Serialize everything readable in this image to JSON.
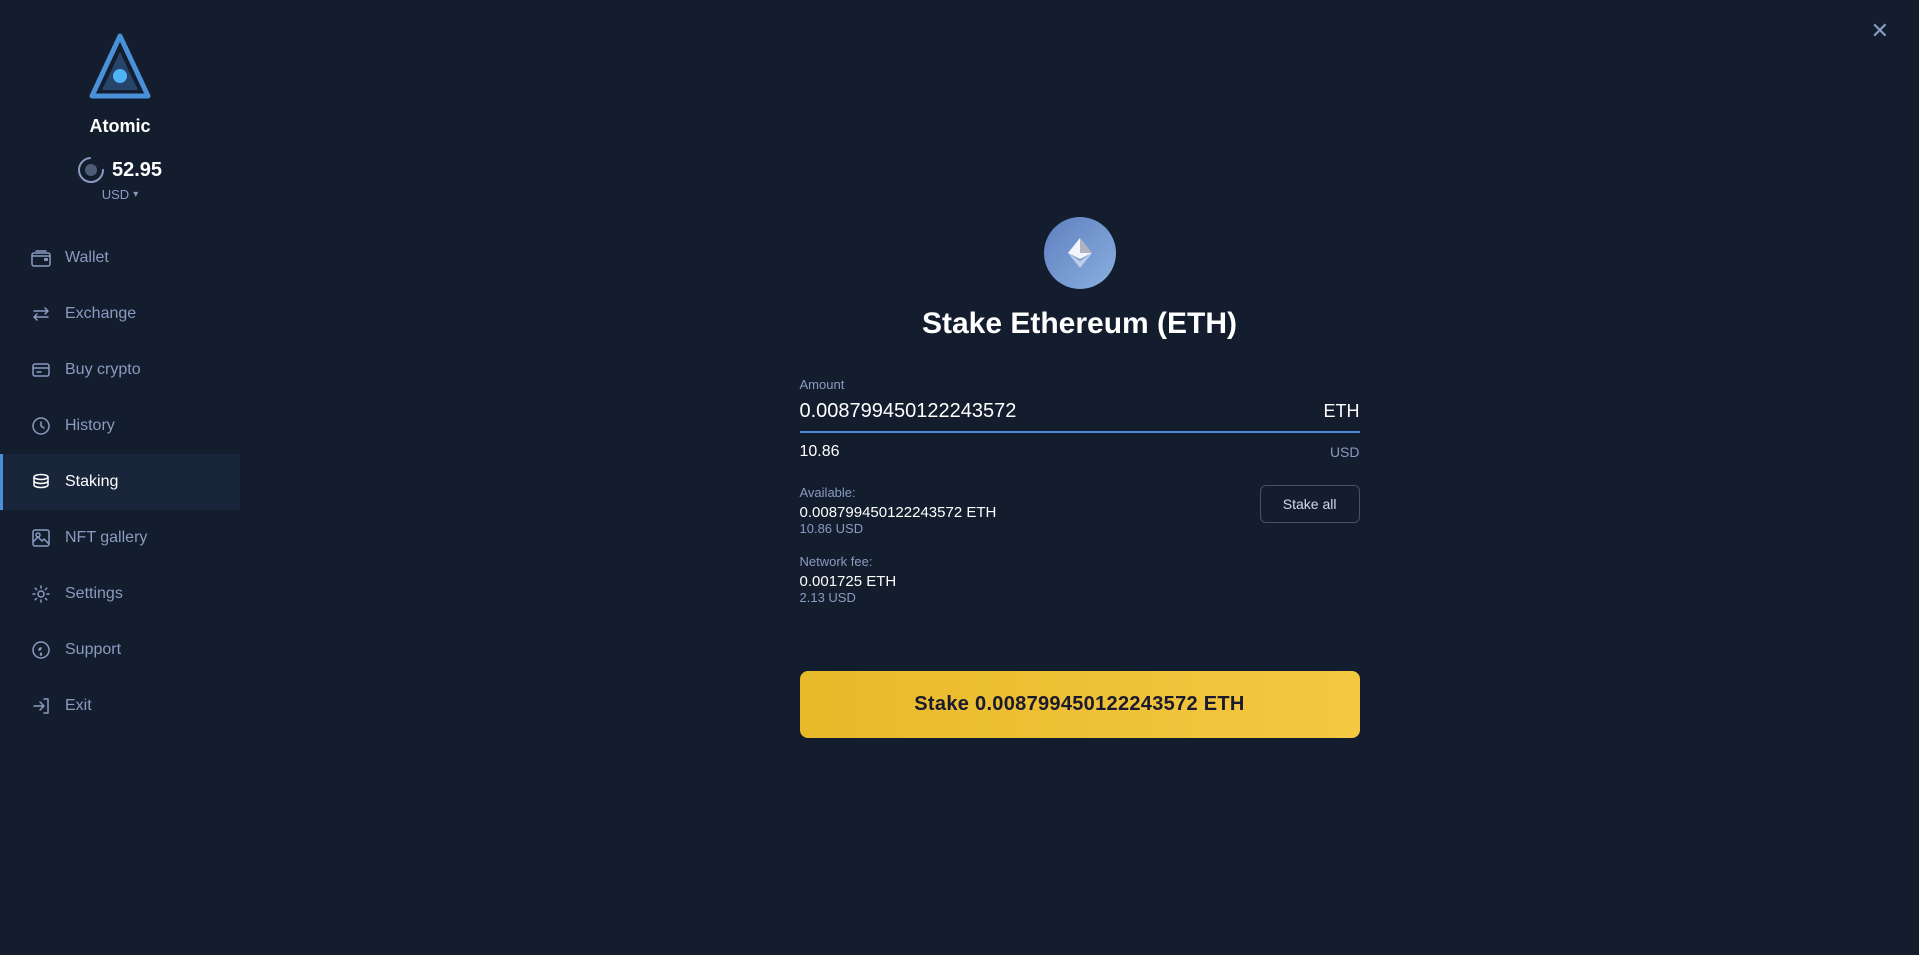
{
  "app": {
    "name": "Atomic"
  },
  "balance": {
    "value": "52.95",
    "currency": "USD"
  },
  "sidebar": {
    "items": [
      {
        "id": "wallet",
        "label": "Wallet",
        "icon": "wallet-icon",
        "active": false
      },
      {
        "id": "exchange",
        "label": "Exchange",
        "icon": "exchange-icon",
        "active": false
      },
      {
        "id": "buy-crypto",
        "label": "Buy crypto",
        "icon": "buy-crypto-icon",
        "active": false
      },
      {
        "id": "history",
        "label": "History",
        "icon": "history-icon",
        "active": false
      },
      {
        "id": "staking",
        "label": "Staking",
        "icon": "staking-icon",
        "active": true
      },
      {
        "id": "nft-gallery",
        "label": "NFT gallery",
        "icon": "nft-icon",
        "active": false
      },
      {
        "id": "settings",
        "label": "Settings",
        "icon": "settings-icon",
        "active": false
      },
      {
        "id": "support",
        "label": "Support",
        "icon": "support-icon",
        "active": false
      },
      {
        "id": "exit",
        "label": "Exit",
        "icon": "exit-icon",
        "active": false
      }
    ]
  },
  "stake": {
    "title": "Stake Ethereum (ETH)",
    "amount_label": "Amount",
    "amount_value": "0.008799450122243572",
    "amount_currency": "ETH",
    "amount_usd": "10.86",
    "amount_usd_label": "USD",
    "available_label": "Available:",
    "available_eth": "0.008799450122243572 ETH",
    "available_usd": "10.86 USD",
    "fee_label": "Network fee:",
    "fee_eth": "0.001725 ETH",
    "fee_usd": "2.13 USD",
    "stake_all_button": "Stake all",
    "submit_button": "Stake 0.008799450122243572 ETH"
  },
  "close_button": "✕"
}
